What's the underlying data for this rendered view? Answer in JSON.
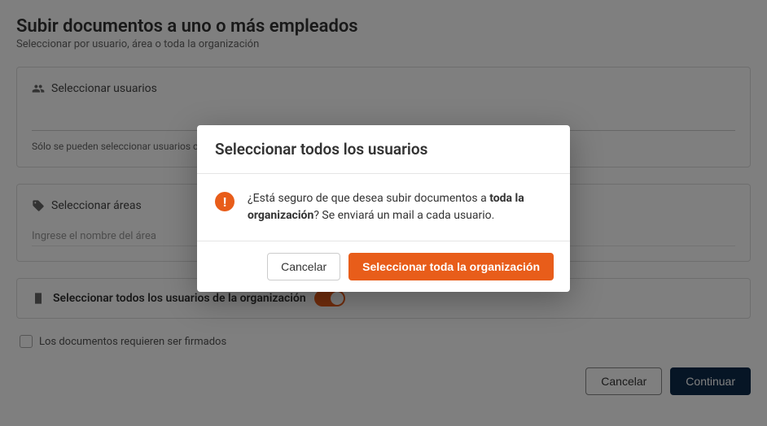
{
  "page": {
    "title": "Subir documentos a uno o más empleados",
    "subtitle": "Seleccionar por usuario, área o toda la organización"
  },
  "users_card": {
    "header": "Seleccionar usuarios",
    "note": "Sólo se pueden seleccionar usuarios con rol \"Usuario\""
  },
  "areas_card": {
    "header": "Seleccionar áreas",
    "placeholder": "Ingrese el nombre del área"
  },
  "select_all": {
    "label": "Seleccionar todos los usuarios de la organización"
  },
  "checkbox": {
    "label": "Los documentos requieren ser firmados"
  },
  "footer": {
    "cancel": "Cancelar",
    "continue": "Continuar"
  },
  "modal": {
    "title": "Seleccionar todos los usuarios",
    "text_pre": "¿Está seguro de que desea subir documentos a ",
    "text_bold": "toda la organización",
    "text_post": "? Se enviará un mail a cada usuario.",
    "cancel": "Cancelar",
    "confirm": "Seleccionar toda la organización"
  }
}
